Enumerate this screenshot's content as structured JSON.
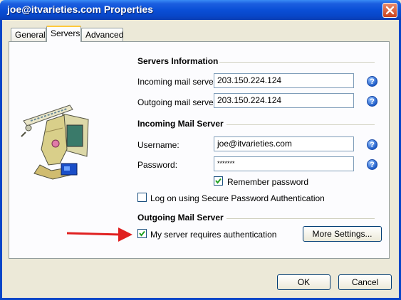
{
  "window": {
    "title": "joe@itvarieties.com Properties",
    "close_icon": "close-icon"
  },
  "tabs": [
    {
      "label": "General"
    },
    {
      "label": "Servers"
    },
    {
      "label": "Advanced"
    }
  ],
  "servers_info": {
    "title": "Servers Information",
    "incoming_label": "Incoming mail server:",
    "incoming_value": "203.150.224.124",
    "outgoing_label": "Outgoing mail server:",
    "outgoing_value": "203.150.224.124"
  },
  "incoming": {
    "title": "Incoming Mail Server",
    "username_label": "Username:",
    "username_value": "joe@itvarieties.com",
    "password_label": "Password:",
    "password_value": "*******",
    "remember_label": "Remember password",
    "spa_label": "Log on using Secure Password Authentication"
  },
  "outgoing": {
    "title": "Outgoing Mail Server",
    "auth_label": "My server requires authentication",
    "more_settings_label": "More Settings..."
  },
  "footer": {
    "ok_label": "OK",
    "cancel_label": "Cancel"
  },
  "help_glyph": "?",
  "colors": {
    "titlebar": "#0a4fd6",
    "arrow": "#e02020",
    "window_bg": "#ece9d8"
  }
}
